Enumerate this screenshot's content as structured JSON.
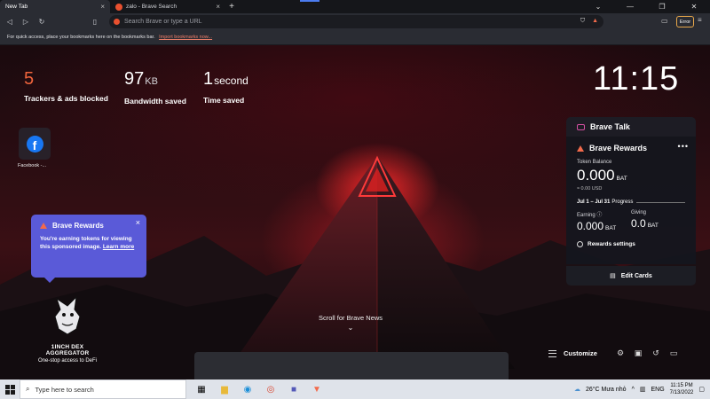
{
  "browser": {
    "tabs": [
      {
        "title": "New Tab",
        "active": true
      },
      {
        "title": "zalo - Brave Search",
        "active": false
      }
    ],
    "new_tab_symbol": "+",
    "omnibox_placeholder": "Search Brave or type a URL",
    "error_label": "Error",
    "bookmarks_text": "For quick access, place your bookmarks here on the bookmarks bar.",
    "bookmarks_link": "Import bookmarks now..."
  },
  "stats": {
    "trackers": {
      "value": "5",
      "label": "Trackers & ads blocked"
    },
    "bandwidth": {
      "value": "97",
      "unit": "KB",
      "label": "Bandwidth saved"
    },
    "time": {
      "value": "1",
      "unit": "second",
      "label": "Time saved"
    }
  },
  "clock": "11:15",
  "top_sites": [
    {
      "label": "Facebook -...",
      "icon": "facebook-icon"
    }
  ],
  "tooltip": {
    "title": "Brave Rewards",
    "body": "You're earning tokens for viewing this sponsored image.",
    "link": "Learn more",
    "close": "×"
  },
  "sponsor": {
    "name": "1INCH DEX AGGREGATOR",
    "tagline": "One-stop access to DeFi"
  },
  "cards": {
    "talk_title": "Brave Talk",
    "rewards_title": "Brave Rewards",
    "token_balance_label": "Token Balance",
    "balance": "0.000",
    "balance_unit": "BAT",
    "usd": "≈ 0.00 USD",
    "progress_range": "Jul 1 – Jul 31",
    "progress_label": "Progress",
    "earning_label": "Earning",
    "earning_value": "0.000",
    "giving_label": "Giving",
    "giving_value": "0.0",
    "settings_label": "Rewards settings",
    "edit_cards": "Edit Cards"
  },
  "news": {
    "scroll_label": "Scroll for Brave News"
  },
  "customize_label": "Customize",
  "taskbar": {
    "search_placeholder": "Type here to search",
    "weather": "26°C  Mưa nhỏ",
    "lang": "ENG",
    "time": "11:15 PM",
    "date": "7/13/2022"
  },
  "colors": {
    "accent": "#f0643c",
    "rewards_tooltip": "#5a5ad8",
    "brave_orange": "#f26a4b"
  }
}
